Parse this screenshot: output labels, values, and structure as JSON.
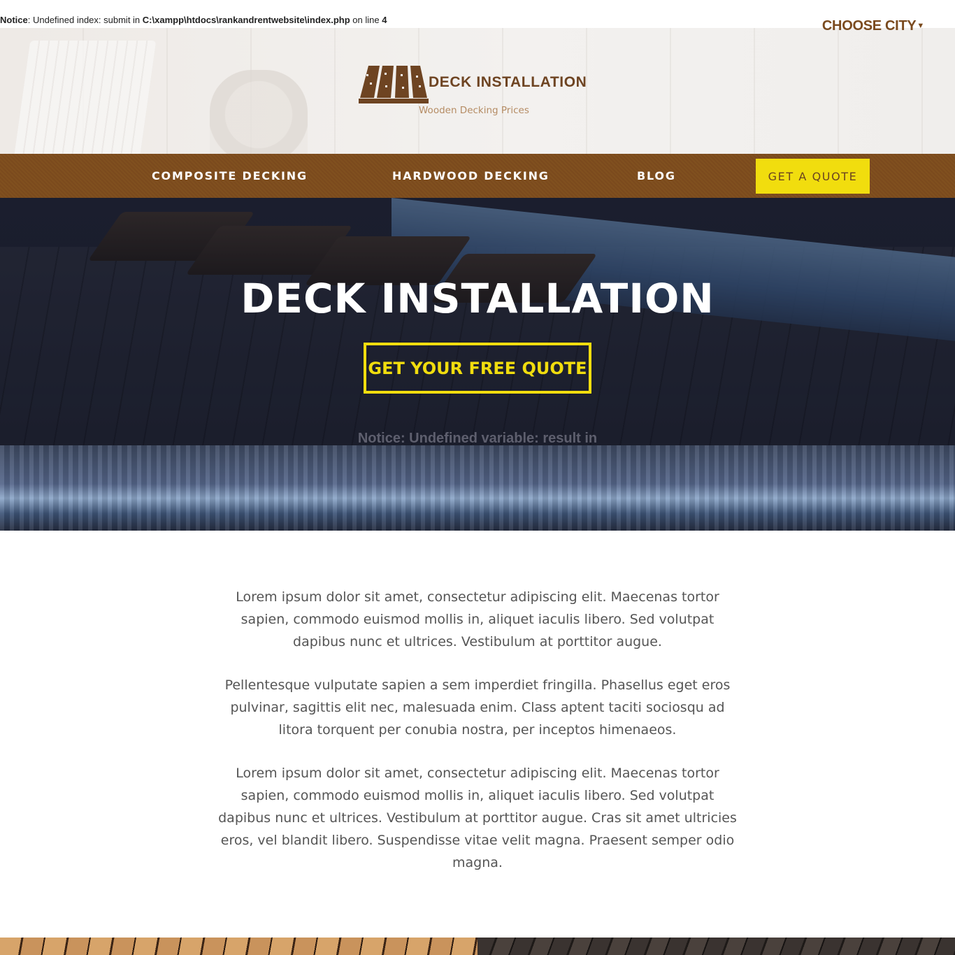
{
  "notice": {
    "label": "Notice",
    "text_1": ": Undefined index: submit in ",
    "path": "C:\\xampp\\htdocs\\rankandrentwebsite\\index.php",
    "text_2": " on line ",
    "line": "4"
  },
  "header": {
    "choose_city": "CHOOSE CITY",
    "choose_city_caret_icon": "caret-down-icon",
    "logo_icon": "deck-planks-icon",
    "brand_name": "DECK INSTALLATION",
    "tagline": "Wooden Decking Prices"
  },
  "nav": {
    "items": [
      {
        "label": "COMPOSITE DECKING"
      },
      {
        "label": "HARDWOOD DECKING"
      },
      {
        "label": "BLOG"
      }
    ],
    "quote_label": "GET A QUOTE"
  },
  "hero": {
    "title": "DECK INSTALLATION",
    "cta_label": "GET YOUR FREE QUOTE",
    "notice_text": "Notice: Undefined variable: result in"
  },
  "content": {
    "paragraphs": [
      "Lorem ipsum dolor sit amet, consectetur adipiscing elit. Maecenas tortor sapien, commodo euismod mollis in, aliquet iaculis libero. Sed volutpat dapibus nunc et ultrices. Vestibulum at porttitor augue.",
      "Pellentesque vulputate sapien a sem imperdiet fringilla. Phasellus eget eros pulvinar, sagittis elit nec, malesuada enim. Class aptent taciti sociosqu ad litora torquent per conubia nostra, per inceptos himenaeos.",
      "Lorem ipsum dolor sit amet, consectetur adipiscing elit. Maecenas tortor sapien, commodo euismod mollis in, aliquet iaculis libero. Sed volutpat dapibus nunc et ultrices. Vestibulum at porttitor augue. Cras sit amet ultricies eros, vel blandit libero. Suspendisse vitae velit magna. Praesent semper odio magna."
    ]
  },
  "colors": {
    "brand_brown": "#7b4a1d",
    "accent_yellow": "#f1dd0e",
    "tagline_tan": "#b58c64"
  }
}
